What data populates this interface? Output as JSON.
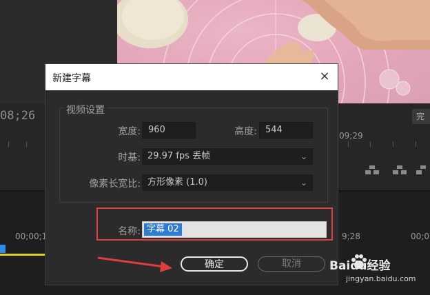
{
  "background": {
    "timecode_left": "08;26",
    "timecode_right": "09;29",
    "done_button": "完",
    "timeline_tc1": "00;00;1",
    "timeline_tc2": "9;28",
    "timeline_tc3": "00;01;"
  },
  "dialog": {
    "title": "新建字幕",
    "close_label": "×",
    "video_settings": {
      "group_label": "视频设置",
      "width_label": "宽度:",
      "width_value": "960",
      "height_label": "高度:",
      "height_value": "544",
      "timebase_label": "时基:",
      "timebase_value": "29.97 fps 丢帧",
      "pixel_aspect_label": "像素长宽比:",
      "pixel_aspect_value": "方形像素 (1.0)"
    },
    "name_label": "名称:",
    "name_value": "字幕 02",
    "ok_label": "确定",
    "cancel_label": "取消"
  },
  "watermark": {
    "brand": "Baidu经验",
    "url": "jingyan.baidu.com"
  },
  "colors": {
    "highlight_box": "#e03e3e",
    "selection": "#2d7bd4",
    "playhead": "#2d8ceb",
    "work_area": "#e4d326"
  }
}
